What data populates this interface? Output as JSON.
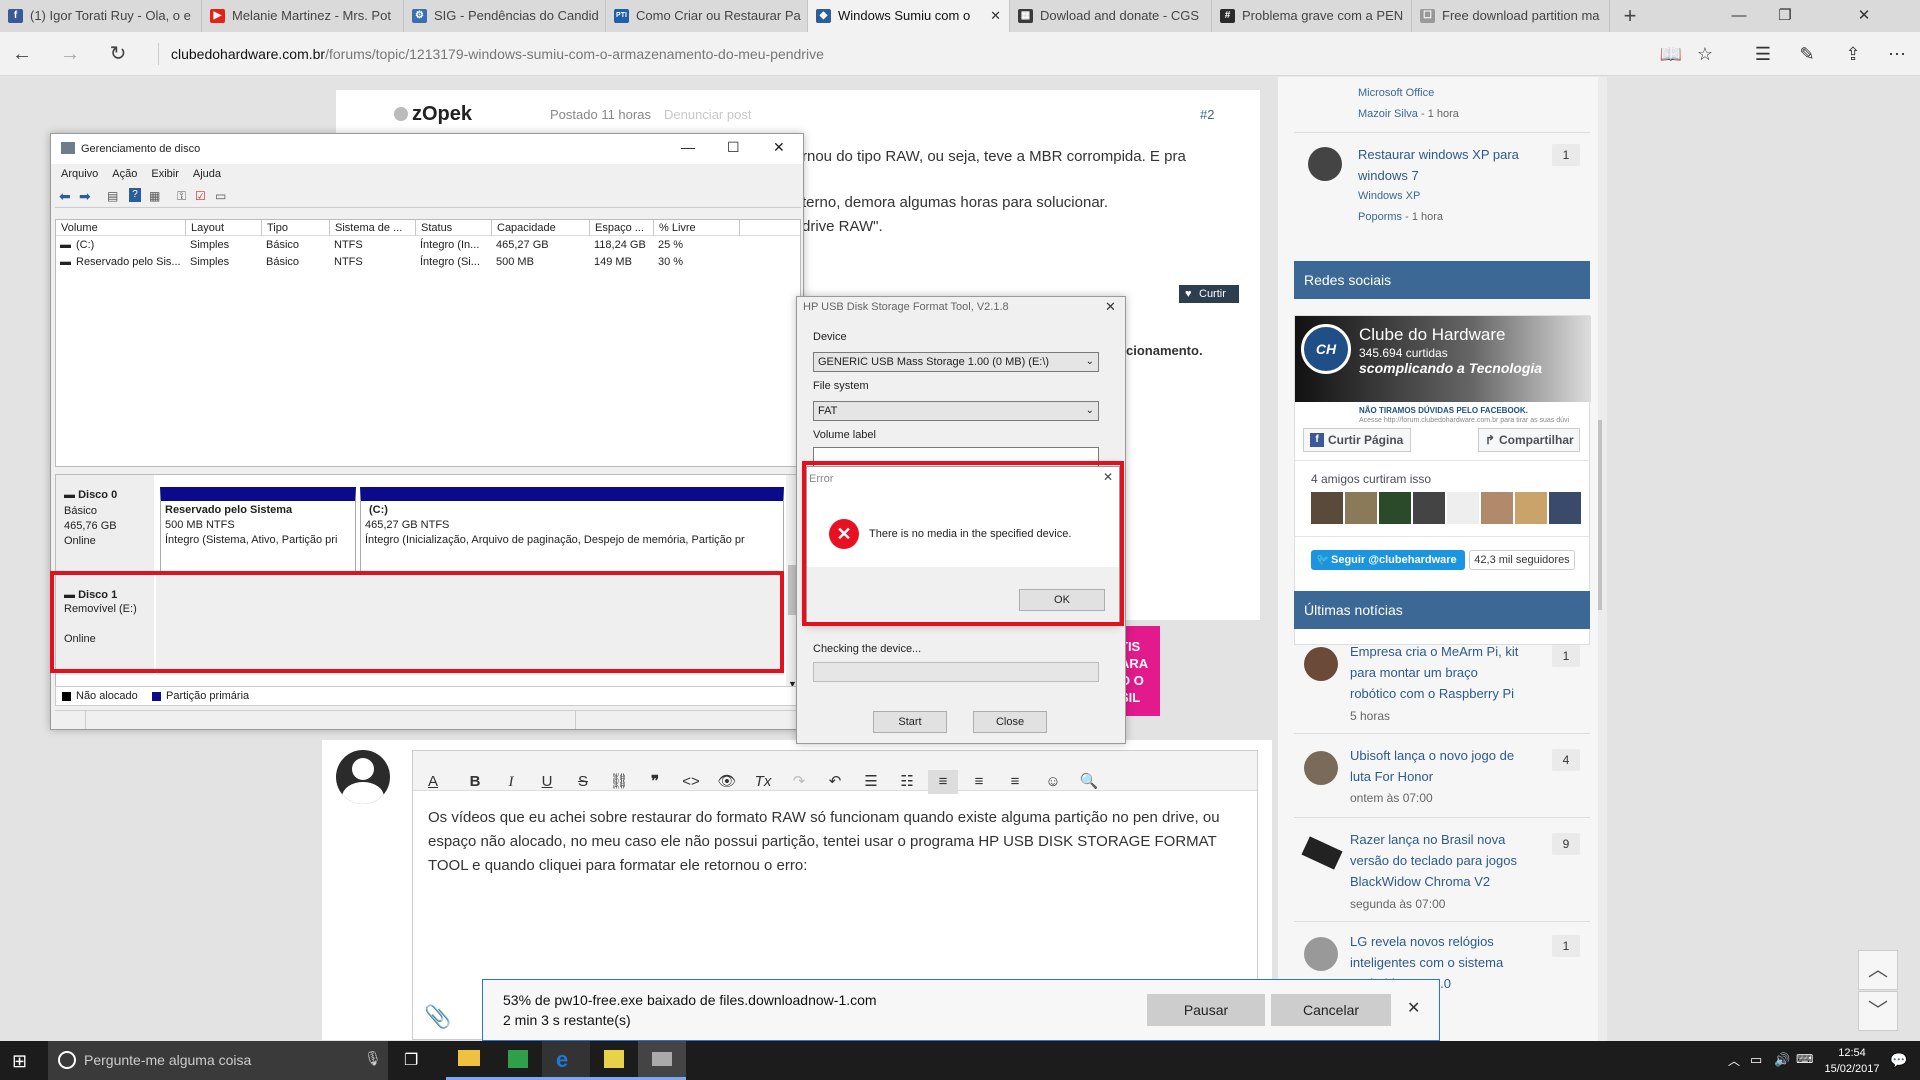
{
  "tabs": [
    {
      "title": "(1) Igor Torati Ruy - Ola, o e",
      "color": "#3b5998",
      "glyph": "f"
    },
    {
      "title": "Melanie Martinez - Mrs. Pot",
      "color": "#e62117",
      "glyph": "▶"
    },
    {
      "title": "SIG - Pendências do Candid",
      "color": "#3a6fb0",
      "glyph": "⚙"
    },
    {
      "title": "Como Criar ou Restaurar Pa",
      "color": "#1d5fa8",
      "glyph": "PTI"
    },
    {
      "title": "Windows Sumiu com o",
      "color": "#2b5d9b",
      "glyph": "◆"
    },
    {
      "title": "Dowload and donate - CGS",
      "color": "#3a3a3a",
      "glyph": "▦"
    },
    {
      "title": "Problema grave com a PEN",
      "color": "#2a2a2a",
      "glyph": "#"
    },
    {
      "title": "Free download partition ma",
      "color": "#999",
      "glyph": "☐"
    }
  ],
  "address": {
    "host": "clubedohardware.com.br",
    "path": "/forums/topic/1213179-windows-sumiu-com-o-armazenamento-do-meu-pendrive"
  },
  "post1": {
    "author": "zOpek",
    "posted": "Postado 11 horas",
    "report": "Denunciar post",
    "number": "#2",
    "line1": "rnou do tipo RAW, ou seja, teve a MBR corrompida. E pra",
    "line2": "terno, demora algumas horas para solucionar.",
    "line3": "drive RAW\".",
    "like": "Curtir",
    "trail": "cionamento."
  },
  "diskmgmt": {
    "title": "Gerenciamento de disco",
    "menu": [
      "Arquivo",
      "Ação",
      "Exibir",
      "Ajuda"
    ],
    "columns": [
      "Volume",
      "Layout",
      "Tipo",
      "Sistema de ...",
      "Status",
      "Capacidade",
      "Espaço ...",
      "% Livre"
    ],
    "rows": [
      [
        "(C:)",
        "Simples",
        "Básico",
        "NTFS",
        "Íntegro (In...",
        "465,27 GB",
        "118,24 GB",
        "25 %"
      ],
      [
        "Reservado pelo Sis...",
        "Simples",
        "Básico",
        "NTFS",
        "Íntegro (Si...",
        "500 MB",
        "149 MB",
        "30 %"
      ]
    ],
    "disk0": {
      "name": "Disco 0",
      "type": "Básico",
      "size": "465,76 GB",
      "state": "Online"
    },
    "part1": {
      "name": "Reservado pelo Sistema",
      "size": "500 MB NTFS",
      "status": "Íntegro (Sistema, Ativo, Partição pri"
    },
    "part2": {
      "name": "(C:)",
      "size": "465,27 GB NTFS",
      "status": "Íntegro (Inicialização, Arquivo de paginação, Despejo de memória, Partição pr"
    },
    "disk1": {
      "name": "Disco 1",
      "type": "Removível (E:)",
      "state": "Online"
    },
    "legend": [
      "Não alocado",
      "Partição primária"
    ]
  },
  "hptool": {
    "title": "HP USB Disk Storage Format Tool, V2.1.8",
    "device_label": "Device",
    "device": "GENERIC USB Mass Storage 1.00 (0 MB) (E:\\)",
    "fs_label": "File system",
    "fs": "FAT",
    "vol_label": "Volume label",
    "checking": "Checking the device...",
    "start": "Start",
    "close": "Close"
  },
  "error": {
    "title": "Error",
    "message": "There is no media in the specified device.",
    "ok": "OK"
  },
  "sidebar": {
    "top_meta_app": "Microsoft Office",
    "top_meta_user": "Mazoir Silva",
    "top_meta_time": "1 hora",
    "topic1": {
      "title1": "Restaurar windows XP para",
      "title2": "windows 7",
      "tag": "Windows XP",
      "user": "Poporms",
      "time": "1 hora",
      "count": "1"
    },
    "social_head": "Redes sociais",
    "fb": {
      "name": "Clube do Hardware",
      "likes": "345.694 curtidas",
      "tag": "scomplicando a Tecnologia",
      "note": "NÃO TIRAMOS DÚVIDAS PELO FACEBOOK.",
      "note2": "Acesse http://forum.clubedohardware.com.br para tirar as suas dúvi",
      "like_btn": "Curtir Página",
      "share_btn": "Compartilhar",
      "friends": "4 amigos curtiram isso"
    },
    "tw": {
      "follow": "Seguir @clubehardware",
      "followers": "42,3 mil seguidores"
    },
    "news_head": "Últimas notícias",
    "news": [
      {
        "l1": "Empresa cria o MeArm Pi, kit",
        "l2": "para montar um braço",
        "l3": "robótico com o Raspberry Pi",
        "time": "5 horas",
        "count": "1"
      },
      {
        "l1": "Ubisoft lança o novo jogo de",
        "l2": "luta For Honor",
        "l3": "",
        "time": "ontem às 07:00",
        "count": "4"
      },
      {
        "l1": "Razer lança no Brasil nova",
        "l2": "versão do teclado para jogos",
        "l3": "BlackWidow Chroma V2",
        "time": "segunda às 07:00",
        "count": "9"
      },
      {
        "l1": "LG revela novos relógios",
        "l2": "inteligentes com o sistema",
        "l3": "Android Wear 2.0",
        "time": "",
        "count": "1"
      }
    ]
  },
  "editor": {
    "p1": "Os vídeos que eu achei sobre restaurar do formato RAW só funcionam quando existe alguma partição no pen drive, ou",
    "p2": "espaço não alocado, no meu caso ele não possui partição, tentei usar o programa HP USB DISK STORAGE FORMAT",
    "p3": "TOOL e quando cliquei para formatar ele retornou o erro:"
  },
  "ad": {
    "l1": "TIS",
    "l2": "ARA",
    "l3": "O O",
    "l4": "SIL"
  },
  "download": {
    "line1": "53% de pw10-free.exe baixado de files.downloadnow-1.com",
    "line2": "2 min 3 s restante(s)",
    "pause": "Pausar",
    "cancel": "Cancelar"
  },
  "taskbar": {
    "search": "Pergunte-me alguma coisa",
    "time": "12:54",
    "date": "15/02/2017"
  }
}
